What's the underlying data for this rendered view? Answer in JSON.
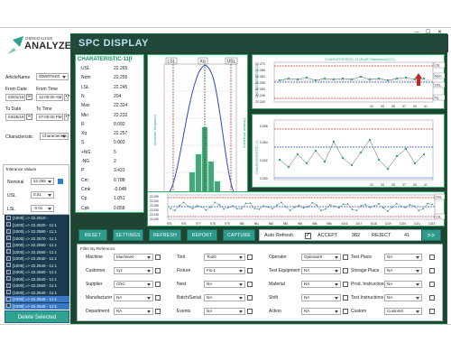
{
  "window": {
    "minimize": "—",
    "maximize": "☐",
    "close": "✕"
  },
  "logo": {
    "small": "OMNIGAUGE",
    "big": "ANALYZE"
  },
  "form": {
    "article_label": "ArticleName",
    "article_value": "00WRTest0",
    "from_date_label": "From Date",
    "from_time_label": "From Time",
    "from_date": "03/01/19",
    "from_time": "12:00:00 AM",
    "to_date_label": "To Date",
    "to_time_label": "To Time",
    "to_date": "03/28/19",
    "to_time": "07:00:00 PM",
    "characteristic_label": "Characteristic",
    "characteristic_value": "Characteristic"
  },
  "tolerance": {
    "title": "Tolerance Values",
    "nominal_label": "Nominal",
    "nominal_value": "22.255",
    "usl_label": "USL",
    "usl_value": "0.01",
    "lsl_label": "LSL",
    "lsl_value": "-0.01"
  },
  "list_items": [
    "[1000] => 22.2510 -",
    "[1000] => 22.2520 - 11:1",
    "[1000] => 22.2550 - 11:1",
    "[1000] => 22.2570 - 11:1",
    "[1000] => 22.2550 - 11:1",
    "[1000] => 22.2550 - 11:1",
    "[1000] => 22.2540 - 11:1",
    "[1000] => 22.2540 - 11:1",
    "[1000] => 22.2560 - 11:1",
    "[1000] => 22.2540 - 11:1",
    "[1000] => 22.2550 - 11:1",
    "[1000] => 22.2540 - 11:1",
    "[1000] => 22.2540 - 11:1",
    "[1000] => 22.2540 - 11:1"
  ],
  "delete_button": "Delete Selected",
  "spc_title": "SPC DISPLAY",
  "stats": {
    "title": "CHARATERISTIC-11[I",
    "rows": [
      {
        "label": "USL",
        "value": "22.265"
      },
      {
        "label": "Nom",
        "value": "22.255"
      },
      {
        "label": "LSL",
        "value": "22.245"
      },
      {
        "label": "N",
        "value": "204"
      },
      {
        "label": "Max",
        "value": "22.324"
      },
      {
        "label": "Min",
        "value": "22.232"
      },
      {
        "label": "R",
        "value": "0.092"
      },
      {
        "label": "Xq",
        "value": "22.257"
      },
      {
        "label": "S",
        "value": "0.003"
      },
      {
        "label": "+NG",
        "value": "5"
      },
      {
        "label": "-NG",
        "value": "2"
      },
      {
        "label": "P",
        "value": "3.431"
      },
      {
        "label": "Cm",
        "value": "0.788"
      },
      {
        "label": "Cmk",
        "value": "-0.048"
      },
      {
        "label": "Cp",
        "value": "1.051"
      },
      {
        "label": "Cpk",
        "value": "0.858"
      }
    ]
  },
  "histogram": {
    "lsl_tag": "LSL",
    "xq_tag": "Xq",
    "usl_tag": "USL",
    "ylabel_left": "Absolute frequency",
    "ylabel_right": "Relative frequency",
    "xlabel": "CHARATERISTIC-11(mm)",
    "xticks": [
      "22.245",
      "22.250",
      "22.255",
      "22.260",
      "22.265"
    ]
  },
  "run_chart": {
    "title": "CHARATERISTIC-11 (Eq/R-Standard/QCC)",
    "ylabel": "CHARATERISTIC-11",
    "yticks": [
      "22.270",
      "22.265",
      "22.260",
      "22.255",
      "22.250",
      "22.245",
      "22.240"
    ],
    "xticks": [
      "31",
      "33",
      "35",
      "37",
      "39",
      "41"
    ],
    "tags": [
      "LSL",
      "Nom",
      "USL",
      "Xq"
    ]
  },
  "r_chart": {
    "ylabel": "CHARATERISTIC-11",
    "yticks": [
      "0.006",
      "0.004",
      "0.002",
      "0.000"
    ],
    "xticks": [
      "31",
      "33",
      "35",
      "37",
      "39",
      "41"
    ]
  },
  "trend_chart": {
    "yticks": [
      "22.265",
      "22.260",
      "22.255",
      "22.250",
      "22.245",
      "22.240"
    ],
    "xticks": [
      "975",
      "976",
      "977",
      "978",
      "979",
      "980",
      "981",
      "982",
      "983",
      "984",
      "985",
      "986",
      "1016",
      "1017",
      "1018",
      "1019",
      "1020",
      "1021",
      "1022"
    ],
    "tags": [
      "USL",
      "LSL"
    ]
  },
  "toolbar": {
    "reset": "RESET",
    "settings": "SETTINGS",
    "refresh": "REFRESH",
    "report": "REPORT",
    "capture": "CAPTURE",
    "auto_refresh": "Auto Refresh",
    "accept_label": "ACCEPT",
    "accept_value": "982",
    "reject_label": "REJECT",
    "reject_value": "41",
    "next": ">>"
  },
  "filter": {
    "title": "Filter By Reference",
    "col1": [
      {
        "label": "Machine",
        "value": "Machine0"
      },
      {
        "label": "Customer",
        "value": "xyz"
      },
      {
        "label": "Supplier",
        "value": "CNC"
      },
      {
        "label": "Manufacturer",
        "value": "NA"
      },
      {
        "label": "Department",
        "value": "NA"
      }
    ],
    "col2": [
      {
        "label": "Tool",
        "value": "Tool0"
      },
      {
        "label": "Fixture",
        "value": "Fix-1"
      },
      {
        "label": "Nest",
        "value": "NA"
      },
      {
        "label": "Batch/Serial",
        "value": "NA"
      },
      {
        "label": "Events",
        "value": "NA"
      }
    ],
    "col3": [
      {
        "label": "Operator",
        "value": "Operator0"
      },
      {
        "label": "Test Equipment",
        "value": "NA"
      },
      {
        "label": "Material",
        "value": "NA"
      },
      {
        "label": "Shift",
        "value": "NA"
      },
      {
        "label": "Action",
        "value": "NA"
      }
    ],
    "col4": [
      {
        "label": "Test Place",
        "value": "NA"
      },
      {
        "label": "Storage Place",
        "value": "NA"
      },
      {
        "label": "Prod. Instructions",
        "value": "NA"
      },
      {
        "label": "Test Instructions",
        "value": "NA"
      },
      {
        "label": "Custom",
        "value": "Custom0"
      }
    ]
  },
  "colors": {
    "accent": "#2d9a8c",
    "panel_bg": "#1f4432",
    "list_bg": "#1a3a50",
    "title_text": "#b8e3f2"
  }
}
